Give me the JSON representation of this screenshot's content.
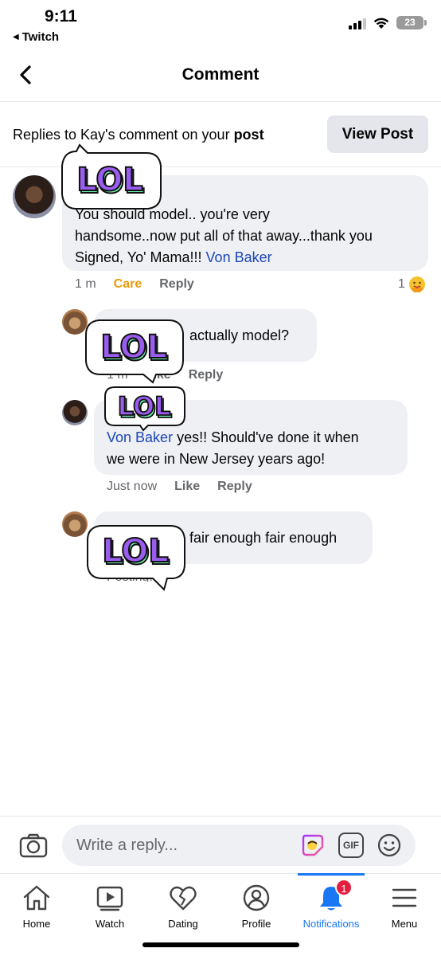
{
  "status_bar": {
    "time": "9:11",
    "back_app": "Twitch",
    "battery": "23"
  },
  "header": {
    "title": "Comment",
    "back_icon": "chevron-left-icon"
  },
  "banner": {
    "prefix": "Replies to Kay's comment on your ",
    "bold": "post",
    "button": "View Post"
  },
  "sticker_text": "LOL",
  "comments": [
    {
      "text": "You should model.. you're very handsome..now put all of that away...thank you Signed, Yo' Mama!!! ",
      "line1": "You should model.. you're very",
      "line2": "handsome..now put all of that away...thank you",
      "line3": "Signed, Yo' Mama!!! ",
      "mention": "Von Baker",
      "time": "1 m",
      "reaction": "Care",
      "reply": "Reply",
      "reaction_count": "1"
    },
    {
      "text": "actually model?",
      "time": "1 m",
      "like": "Like",
      "reply": "Reply"
    },
    {
      "mention": "Von Baker",
      "text_line1": " yes!! Should've done it when",
      "text_line2": "we were in New Jersey years ago!",
      "time": "Just now",
      "like": "Like",
      "reply": "Reply"
    },
    {
      "text": "fair enough fair enough",
      "status": "Posting..."
    }
  ],
  "reply_bar": {
    "placeholder": "Write a reply...",
    "gif_label": "GIF"
  },
  "tabs": [
    {
      "label": "Home",
      "icon": "home-icon"
    },
    {
      "label": "Watch",
      "icon": "video-icon"
    },
    {
      "label": "Dating",
      "icon": "heart-icon"
    },
    {
      "label": "Profile",
      "icon": "profile-icon"
    },
    {
      "label": "Notifications",
      "icon": "bell-icon",
      "badge": "1",
      "active": true
    },
    {
      "label": "Menu",
      "icon": "menu-icon"
    }
  ],
  "colors": {
    "accent": "#1877f2",
    "care": "#e89c0c",
    "link": "#1a47b8",
    "badge": "#e41e3f"
  }
}
